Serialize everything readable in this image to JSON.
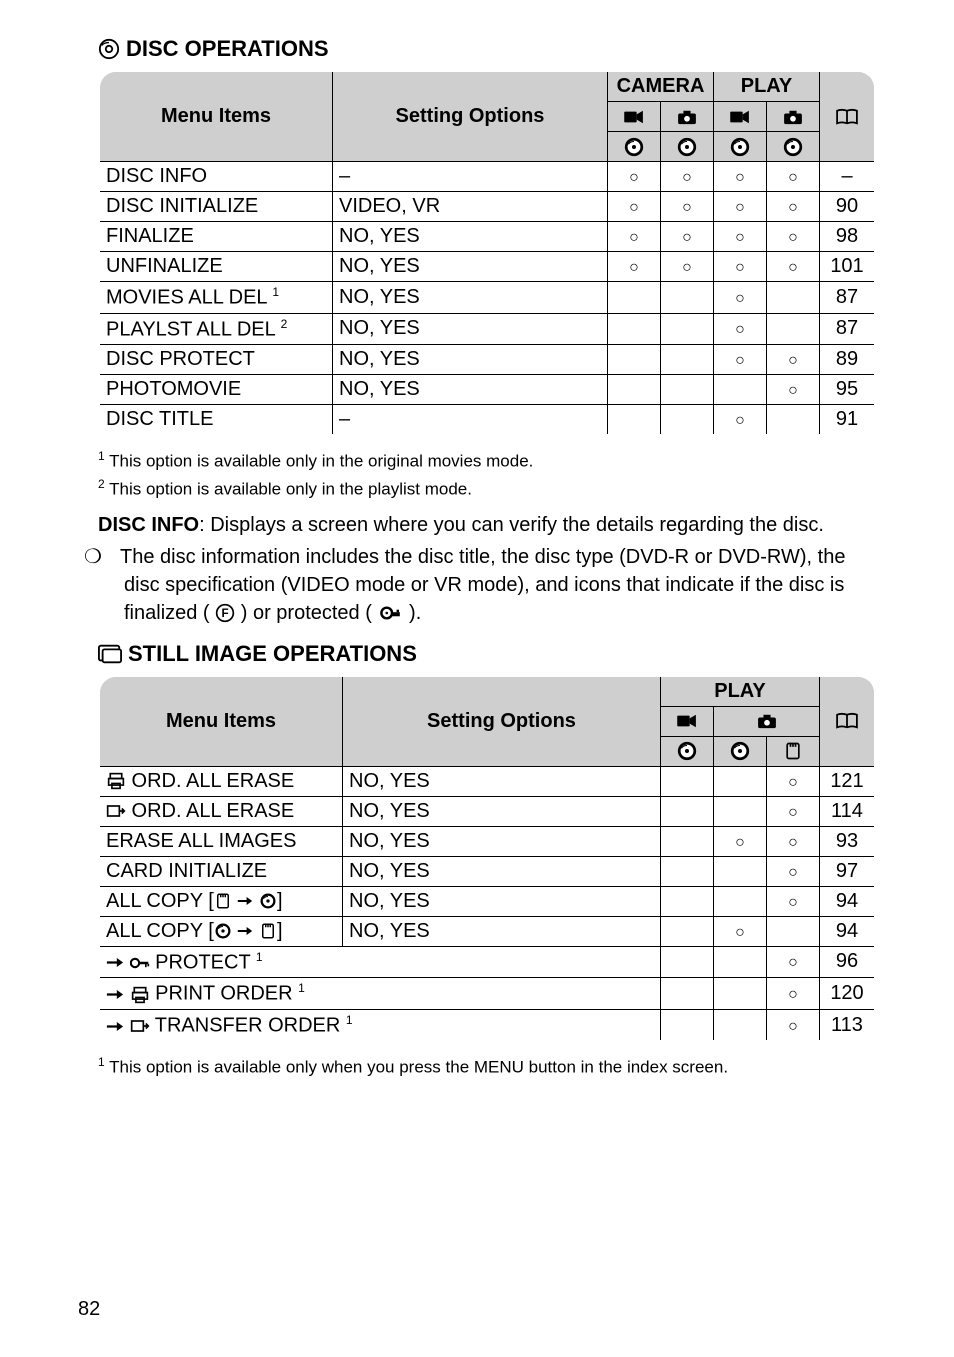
{
  "page_number": "82",
  "section1": {
    "title": "DISC OPERATIONS",
    "header": {
      "menu_items": "Menu Items",
      "setting_options": "Setting Options",
      "camera": "CAMERA",
      "play": "PLAY"
    },
    "rows": [
      {
        "name": "DISC INFO",
        "opts": "–",
        "c1": "○",
        "c2": "○",
        "c3": "○",
        "c4": "○",
        "pg": "–"
      },
      {
        "name": "DISC INITIALIZE",
        "opts": "VIDEO, VR",
        "c1": "○",
        "c2": "○",
        "c3": "○",
        "c4": "○",
        "pg": "90"
      },
      {
        "name": "FINALIZE",
        "opts": "NO, YES",
        "c1": "○",
        "c2": "○",
        "c3": "○",
        "c4": "○",
        "pg": "98"
      },
      {
        "name": "UNFINALIZE",
        "opts": "NO, YES",
        "c1": "○",
        "c2": "○",
        "c3": "○",
        "c4": "○",
        "pg": "101"
      },
      {
        "name": "MOVIES ALL DEL",
        "sup": "1",
        "opts": "NO, YES",
        "c1": "",
        "c2": "",
        "c3": "○",
        "c4": "",
        "pg": "87"
      },
      {
        "name": "PLAYLST ALL DEL",
        "sup": "2",
        "opts": "NO, YES",
        "c1": "",
        "c2": "",
        "c3": "○",
        "c4": "",
        "pg": "87"
      },
      {
        "name": "DISC PROTECT",
        "opts": "NO, YES",
        "c1": "",
        "c2": "",
        "c3": "○",
        "c4": "○",
        "pg": "89"
      },
      {
        "name": "PHOTOMOVIE",
        "opts": "NO, YES",
        "c1": "",
        "c2": "",
        "c3": "",
        "c4": "○",
        "pg": "95"
      },
      {
        "name": "DISC TITLE",
        "opts": "–",
        "c1": "",
        "c2": "",
        "c3": "○",
        "c4": "",
        "pg": "91"
      }
    ]
  },
  "footnotes1": {
    "f1": "This option is available only in the original movies mode.",
    "f2": "This option is available only in the playlist mode."
  },
  "disc_info": {
    "label": "DISC INFO",
    "text": ": Displays a screen where you can verify the details regarding the disc.",
    "bullet_a": "The disc information includes the disc title, the disc type (DVD-R or DVD-RW), the disc specification (VIDEO mode or VR mode), and icons that indicate if the disc is finalized (",
    "bullet_b": ") or protected (",
    "bullet_c": ")."
  },
  "section2": {
    "title": "STILL IMAGE OPERATIONS",
    "header": {
      "menu_items": "Menu Items",
      "setting_options": "Setting Options",
      "play": "PLAY"
    },
    "rows": [
      {
        "label": "ORD. ALL ERASE",
        "preicon": "print",
        "opts": "NO, YES",
        "c1": "",
        "c2": "",
        "c3": "○",
        "pg": "121"
      },
      {
        "label": "ORD. ALL ERASE",
        "preicon": "transfer",
        "opts": "NO, YES",
        "c1": "",
        "c2": "",
        "c3": "○",
        "pg": "114"
      },
      {
        "label": "ERASE ALL IMAGES",
        "opts": "NO, YES",
        "c1": "",
        "c2": "○",
        "c3": "○",
        "pg": "93"
      },
      {
        "label": "CARD INITIALIZE",
        "opts": "NO, YES",
        "c1": "",
        "c2": "",
        "c3": "○",
        "pg": "97"
      },
      {
        "label": "ALL COPY [",
        "posticon": "card2disc",
        "closebracket": "]",
        "opts": "NO, YES",
        "c1": "",
        "c2": "",
        "c3": "○",
        "pg": "94"
      },
      {
        "label": "ALL COPY [",
        "posticon": "disc2card",
        "closebracket": "]",
        "opts": "NO, YES",
        "c1": "",
        "c2": "○",
        "c3": "",
        "pg": "94"
      },
      {
        "label": "PROTECT",
        "arrow": true,
        "preicon": "key",
        "sup": "1",
        "span": true,
        "c1": "",
        "c2": "",
        "c3": "○",
        "pg": "96"
      },
      {
        "label": "PRINT ORDER",
        "arrow": true,
        "preicon": "print",
        "sup": "1",
        "span": true,
        "c1": "",
        "c2": "",
        "c3": "○",
        "pg": "120"
      },
      {
        "label": "TRANSFER ORDER",
        "arrow": true,
        "preicon": "transfer",
        "sup": "1",
        "span": true,
        "c1": "",
        "c2": "",
        "c3": "○",
        "pg": "113"
      }
    ]
  },
  "footnotes2": {
    "f1": "This option is available only when you press the MENU button in the index screen."
  }
}
